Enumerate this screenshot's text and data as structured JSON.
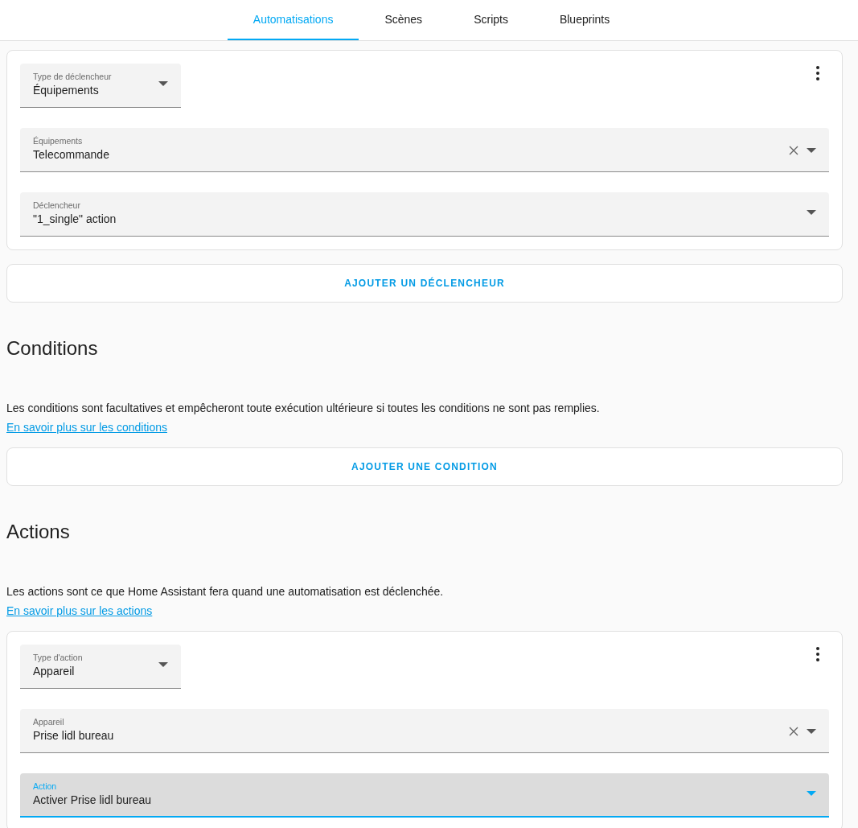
{
  "tabs": [
    {
      "label": "Automatisations",
      "selected": true
    },
    {
      "label": "Scènes",
      "selected": false
    },
    {
      "label": "Scripts",
      "selected": false
    },
    {
      "label": "Blueprints",
      "selected": false
    }
  ],
  "trigger_card": {
    "fields": [
      {
        "kind": "compact",
        "label": "Type de déclencheur",
        "value": "Équipements",
        "clearable": false,
        "focused": false
      },
      {
        "kind": "full",
        "label": "Équipements",
        "value": "Telecommande",
        "clearable": true,
        "focused": false
      },
      {
        "kind": "full",
        "label": "Déclencheur",
        "value": "\"1_single\" action",
        "clearable": false,
        "focused": false
      }
    ]
  },
  "add_trigger_button": "AJOUTER UN DÉCLENCHEUR",
  "conditions": {
    "heading": "Conditions",
    "description": "Les conditions sont facultatives et empêcheront toute exécution ultérieure si toutes les conditions ne sont pas remplies.",
    "link": "En savoir plus sur les conditions",
    "button": "AJOUTER UNE CONDITION"
  },
  "actions": {
    "heading": "Actions",
    "description": "Les actions sont ce que Home Assistant fera quand une automatisation est déclenchée.",
    "link": "En savoir plus sur les actions"
  },
  "action_card": {
    "fields": [
      {
        "kind": "compact",
        "label": "Type d'action",
        "value": "Appareil",
        "clearable": false,
        "focused": false
      },
      {
        "kind": "full",
        "label": "Appareil",
        "value": "Prise lidl bureau",
        "clearable": true,
        "focused": false
      },
      {
        "kind": "full",
        "label": "Action",
        "value": "Activer Prise lidl bureau",
        "clearable": false,
        "focused": true
      }
    ]
  }
}
